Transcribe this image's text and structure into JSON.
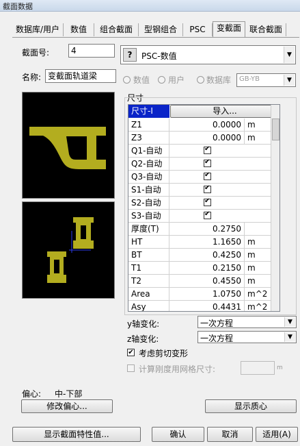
{
  "window": {
    "title": "截面数据"
  },
  "tabs": [
    {
      "label": "数据库/用户"
    },
    {
      "label": "数值"
    },
    {
      "label": "组合截面"
    },
    {
      "label": "型钢组合"
    },
    {
      "label": "PSC"
    },
    {
      "label": "变截面"
    },
    {
      "label": "联合截面"
    }
  ],
  "section": {
    "number_label": "截面号:",
    "number_value": "4",
    "name_label": "名称:",
    "name_value": "变截面轨道梁",
    "type_value": "PSC-数值",
    "radio_value": "数值",
    "radio_user": "用户",
    "radio_db": "数据库",
    "db_value": "GB-YB"
  },
  "dims": {
    "group_label": "尺寸",
    "header_col1": "尺寸-I",
    "header_col2": "导入...",
    "rows": [
      {
        "name": "Z1",
        "value": "0.0000",
        "unit": "m"
      },
      {
        "name": "Z3",
        "value": "0.0000",
        "unit": "m"
      },
      {
        "name": "Q1-自动",
        "check": true
      },
      {
        "name": "Q2-自动",
        "check": true
      },
      {
        "name": "Q3-自动",
        "check": true
      },
      {
        "name": "S1-自动",
        "check": true
      },
      {
        "name": "S2-自动",
        "check": true
      },
      {
        "name": "S3-自动",
        "check": true
      },
      {
        "name": "厚度(T)",
        "value": "0.2750",
        "unit": ""
      },
      {
        "name": "HT",
        "value": "1.1650",
        "unit": "m"
      },
      {
        "name": "BT",
        "value": "0.4250",
        "unit": "m"
      },
      {
        "name": "T1",
        "value": "0.2150",
        "unit": "m"
      },
      {
        "name": "T2",
        "value": "0.4550",
        "unit": "m"
      },
      {
        "name": "Area",
        "value": "1.0750",
        "unit": "m^2"
      },
      {
        "name": "Asy",
        "value": "0.4431",
        "unit": "m^2"
      }
    ]
  },
  "variation": {
    "y_label": "y轴变化:",
    "y_value": "一次方程",
    "z_label": "z轴变化:",
    "z_value": "一次方程",
    "shear_label": "考虑剪切变形",
    "mesh_label": "计算刚度用网格尺寸:",
    "mesh_unit": "m"
  },
  "offset": {
    "label": "偏心:",
    "value": "中-下部",
    "modify_button": "修改偏心...",
    "centroid_button": "显示质心"
  },
  "footer": {
    "props_button": "显示截面特性值...",
    "ok_button": "确认",
    "cancel_button": "取消",
    "apply_button": "适用(A)"
  },
  "colors": {
    "shape": "#b3ad1f",
    "selection": "#0a24c8"
  }
}
